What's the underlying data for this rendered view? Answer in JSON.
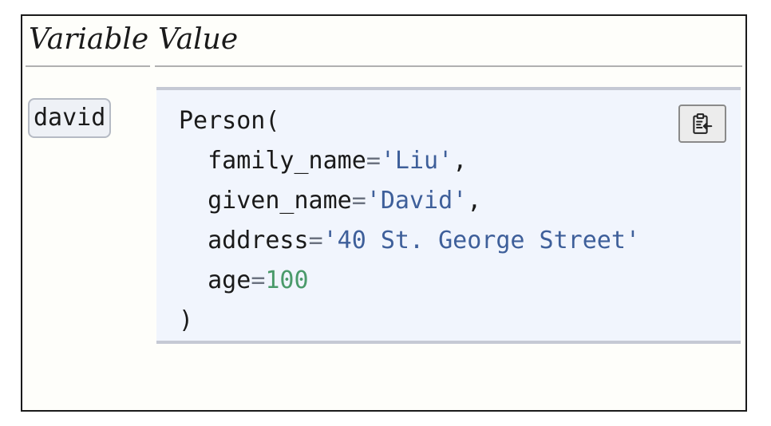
{
  "table": {
    "header_variable": "Variable",
    "header_value": "Value"
  },
  "row": {
    "variable_name": "david",
    "value": {
      "class_name": "Person(",
      "fields": [
        {
          "name": "family_name",
          "eq": "=",
          "value": "'Liu'",
          "sep": ",",
          "kind": "string"
        },
        {
          "name": "given_name",
          "eq": "=",
          "value": "'David'",
          "sep": ",",
          "kind": "string"
        },
        {
          "name": "address",
          "eq": "=",
          "value": "'40 St. George Street'",
          "sep": "",
          "kind": "string"
        },
        {
          "name": "age",
          "eq": "=",
          "value": "100",
          "sep": "",
          "kind": "number"
        }
      ],
      "closing": ")",
      "indent": "  "
    },
    "copy_button_icon": "clipboard-copy-icon"
  },
  "colors": {
    "string": "#3e5f9a",
    "number": "#4a9a6a",
    "operator": "#6b7280",
    "code_background": "#f1f5fd"
  }
}
